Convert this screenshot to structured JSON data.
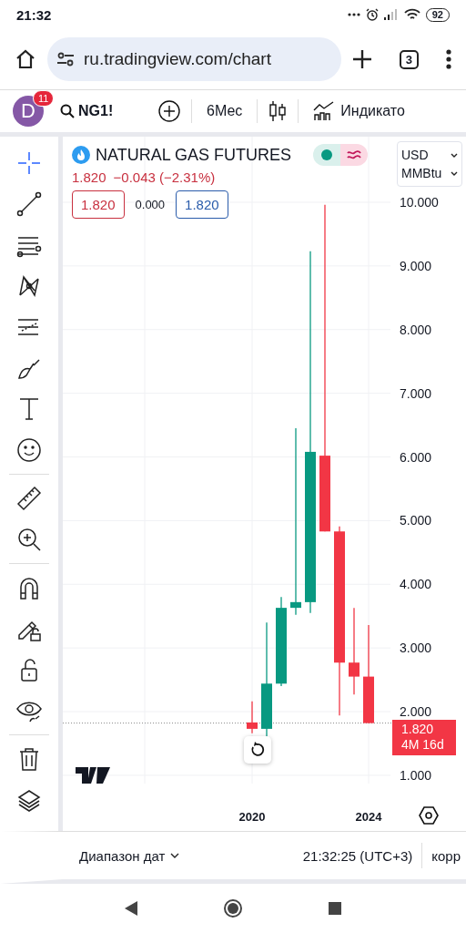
{
  "status_bar": {
    "time": "21:32",
    "battery": "92"
  },
  "browser": {
    "url": "ru.tradingview.com/chart",
    "tab_count": "3"
  },
  "top_toolbar": {
    "avatar_letter": "D",
    "notification_count": "11",
    "symbol": "NG1!",
    "interval": "6Мес",
    "indicators": "Индикато"
  },
  "drawing_tools": [
    {
      "kind": "crosshair",
      "selected": true
    },
    {
      "kind": "trend-line",
      "selected": false
    },
    {
      "kind": "fib",
      "selected": false
    },
    {
      "kind": "pattern",
      "selected": false
    },
    {
      "kind": "forecast",
      "selected": false
    },
    {
      "kind": "brush",
      "selected": false
    },
    {
      "kind": "text",
      "selected": false
    },
    {
      "kind": "emoji",
      "selected": false
    },
    {
      "kind": "divider"
    },
    {
      "kind": "ruler",
      "selected": false
    },
    {
      "kind": "zoom",
      "selected": false
    },
    {
      "kind": "divider"
    },
    {
      "kind": "magnet",
      "selected": false
    },
    {
      "kind": "lock-drawing",
      "selected": false
    },
    {
      "kind": "lock",
      "selected": false
    },
    {
      "kind": "hide",
      "selected": false
    },
    {
      "kind": "divider"
    },
    {
      "kind": "trash",
      "selected": false
    },
    {
      "kind": "layers",
      "selected": false
    }
  ],
  "legend": {
    "title": "NATURAL GAS FUTURES",
    "price": "1.820",
    "change": "−0.043 (−2.31%)",
    "sell": "1.820",
    "spread": "0.000",
    "buy": "1.820"
  },
  "currency": {
    "currency": "USD",
    "unit": "MMBtu"
  },
  "chart_data": {
    "type": "candlestick",
    "grid": true,
    "xlim": [
      "2013-07",
      "2024-10"
    ],
    "ylim": [
      0.87,
      11.03
    ],
    "ref_lines": [
      {
        "axis": "y",
        "value": 1.82
      }
    ],
    "x": [
      "2020-01",
      "2020-07",
      "2021-01",
      "2021-07",
      "2022-01",
      "2022-07",
      "2023-01",
      "2023-07",
      "2024-01"
    ],
    "ohlc": [
      [
        1.83,
        2.16,
        1.66,
        1.73
      ],
      [
        1.73,
        3.4,
        1.59,
        2.44
      ],
      [
        2.44,
        3.8,
        2.4,
        3.63
      ],
      [
        3.63,
        6.45,
        3.52,
        3.72
      ],
      [
        3.72,
        9.23,
        3.55,
        6.08
      ],
      [
        6.02,
        9.96,
        4.83,
        4.83
      ],
      [
        4.83,
        4.91,
        1.94,
        2.77
      ],
      [
        2.77,
        3.63,
        2.27,
        2.55
      ],
      [
        2.55,
        3.36,
        1.82,
        1.82
      ]
    ],
    "xticks": [
      {
        "value": "2020-01",
        "label": "2020"
      },
      {
        "value": "2024-01",
        "label": "2024"
      }
    ],
    "yticks": [
      {
        "value": 10,
        "label": "10.000"
      },
      {
        "value": 9,
        "label": "9.000"
      },
      {
        "value": 8,
        "label": "8.000"
      },
      {
        "value": 7,
        "label": "7.000"
      },
      {
        "value": 6,
        "label": "6.000"
      },
      {
        "value": 5,
        "label": "5.000"
      },
      {
        "value": 4,
        "label": "4.000"
      },
      {
        "value": 3,
        "label": "3.000"
      },
      {
        "value": 2,
        "label": "2.000"
      },
      {
        "value": 1,
        "label": "1.000"
      }
    ]
  },
  "last_price": {
    "price": "1.820",
    "countdown": "4M 16d"
  },
  "bottom_bar": {
    "date_range": "Диапазон дат",
    "clock": "21:32:25 (UTC+3)",
    "adjust": "корр"
  }
}
